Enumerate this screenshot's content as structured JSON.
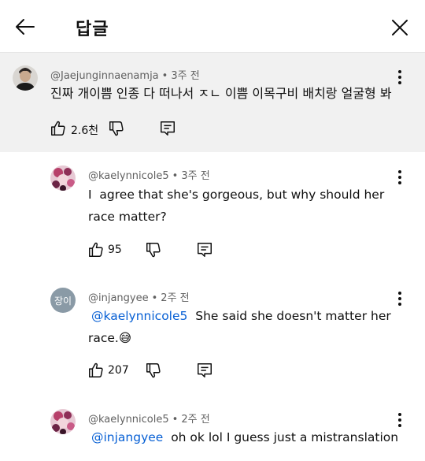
{
  "header": {
    "title": "답글"
  },
  "parent": {
    "username": "@Jaejunginnaenamja",
    "time": "3주 전",
    "text": "진짜 개이쁨 인종 다 떠나서 ㅈㄴ 이쁨 이목구비 배치랑 얼굴형 봐",
    "likes": "2.6천"
  },
  "replies": [
    {
      "username": "@kaelynnicole5",
      "time": "3주 전",
      "text_line1": "I  agree that she's gorgeous, but why should her",
      "text_line2": "race matter?",
      "likes": "95"
    },
    {
      "username": "@injangyee",
      "time": "2주 전",
      "avatar_text": "장이",
      "mention": "@kaelynnicole5",
      "text_line1_rest": "She said she doesn't matter her",
      "text_line2": "race.",
      "emoji": "😅",
      "likes": "207"
    },
    {
      "username": "@kaelynnicole5",
      "time": "2주 전",
      "mention": "@injangyee",
      "text_line1_rest": "oh ok lol I guess just a mistranslation"
    }
  ],
  "separator": "•"
}
